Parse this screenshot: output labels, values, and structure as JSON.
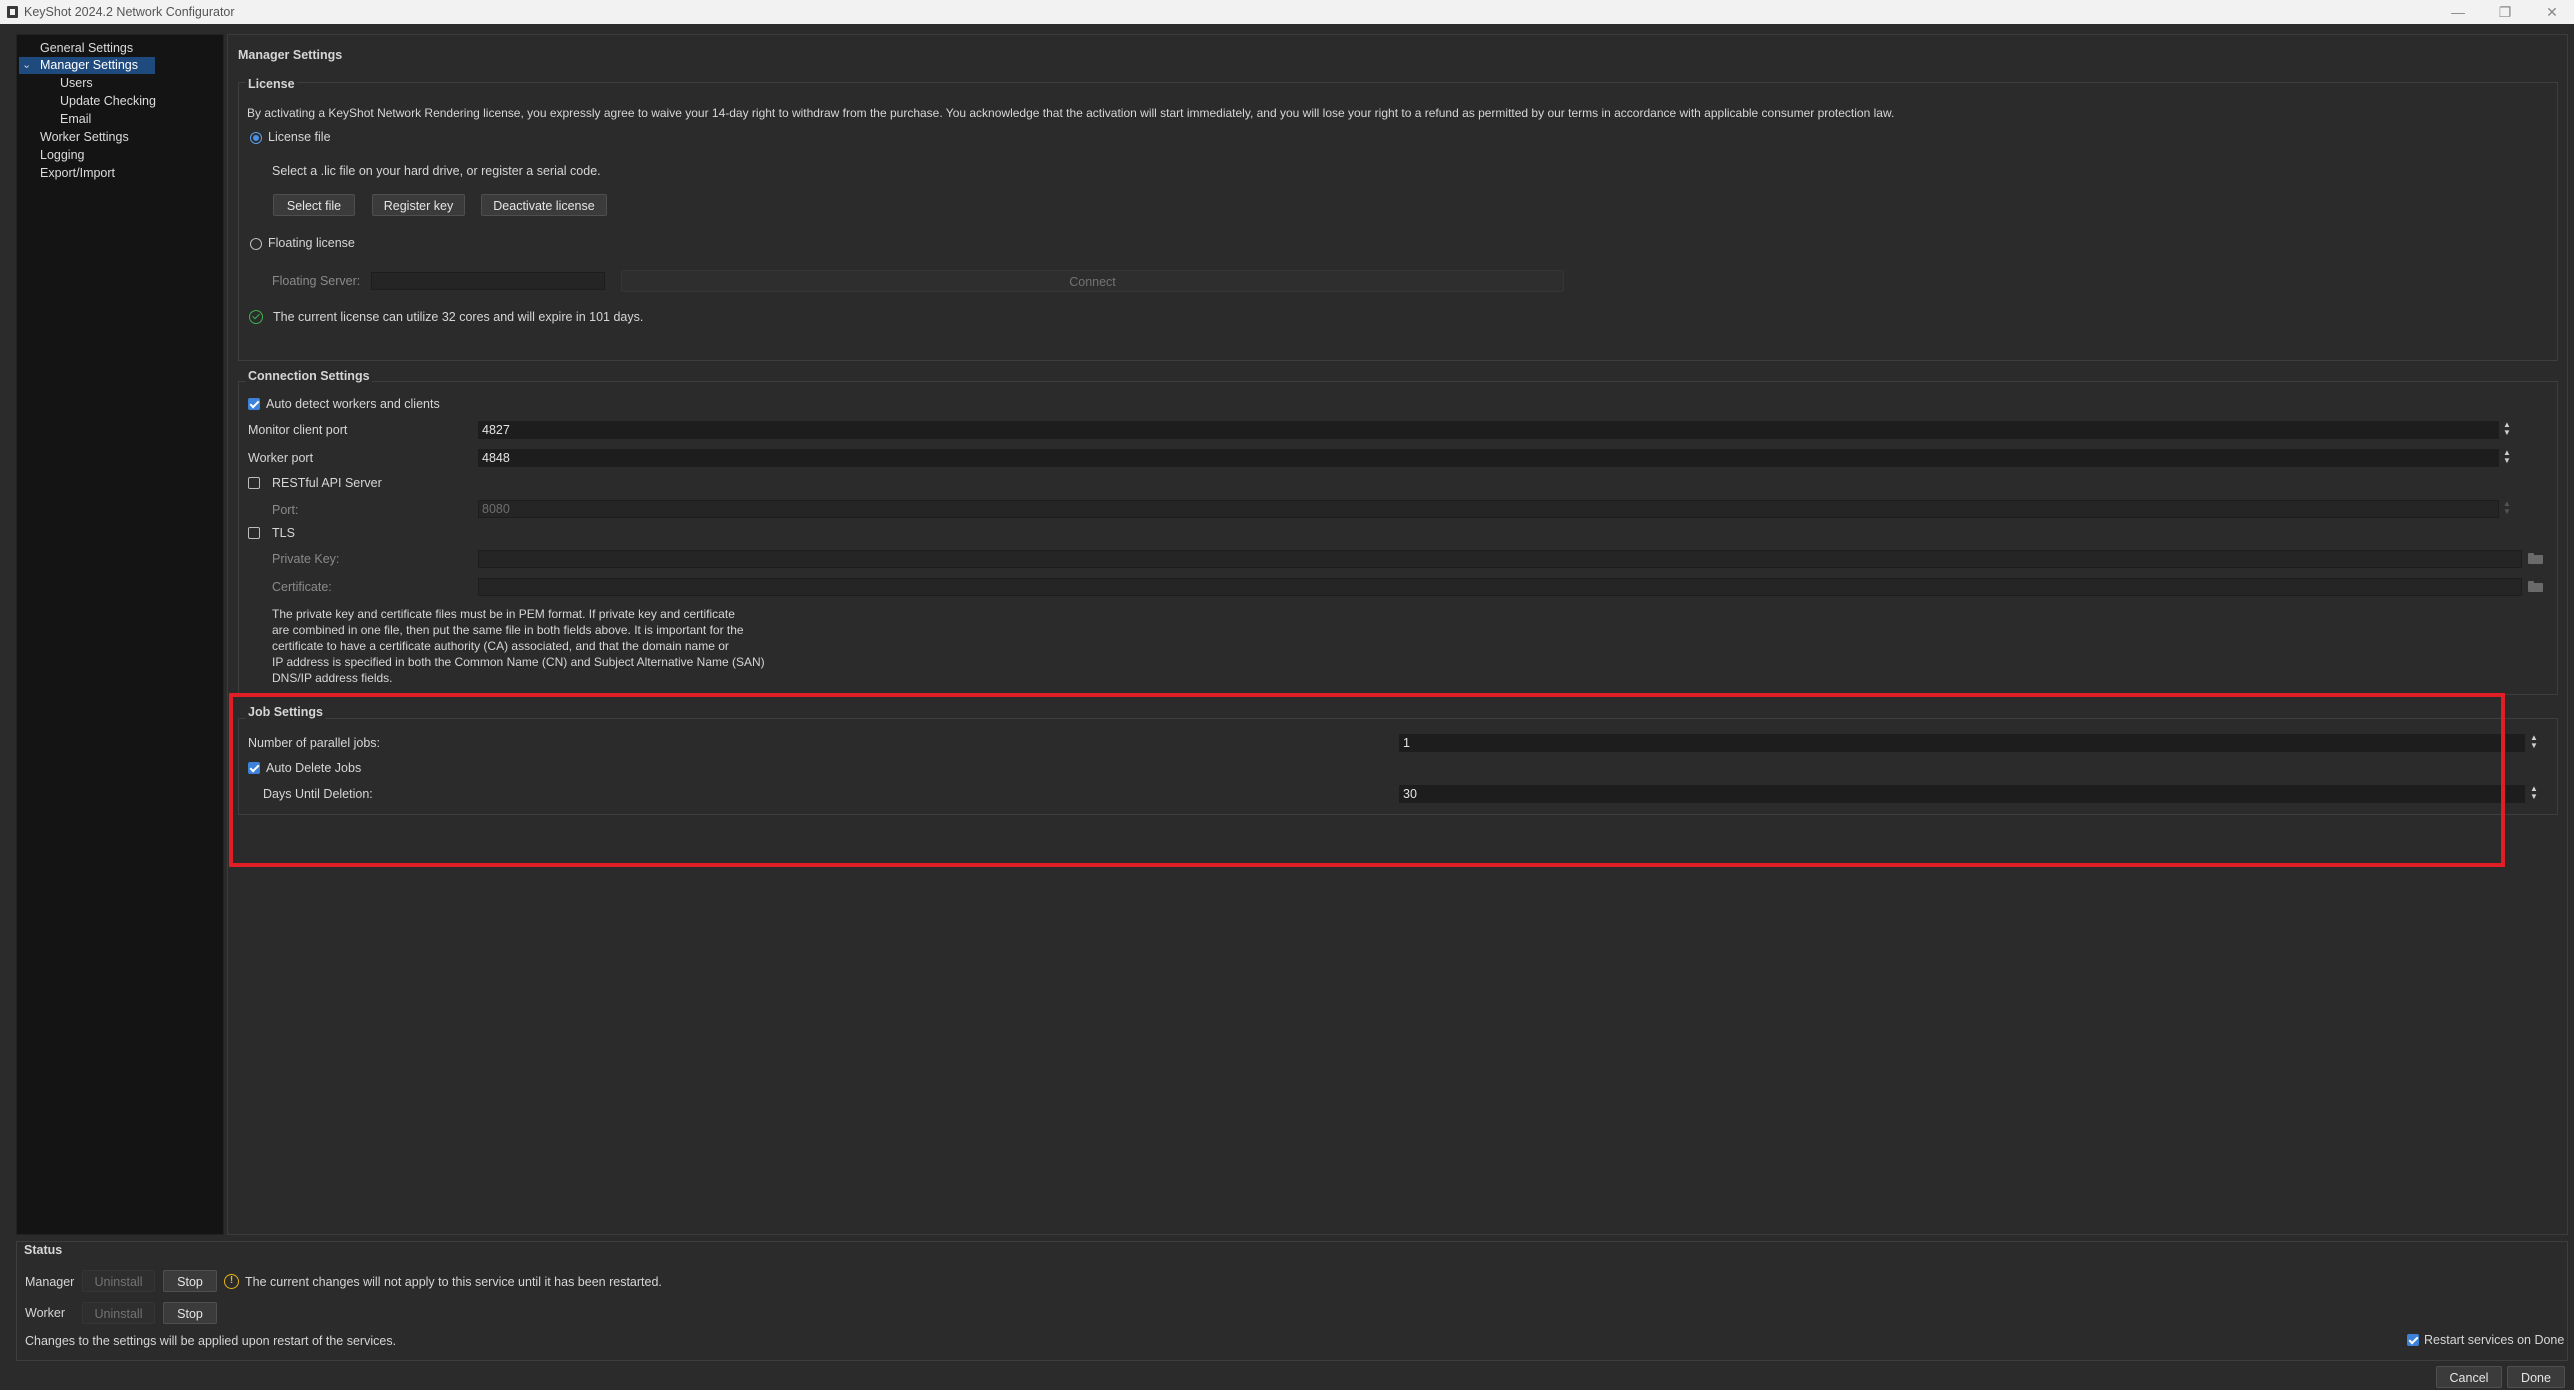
{
  "window": {
    "title": "KeyShot 2024.2 Network Configurator",
    "controls": {
      "minimize": "—",
      "restore": "❐",
      "close": "✕"
    }
  },
  "sidebar": {
    "items": [
      {
        "label": "General Settings"
      },
      {
        "label": "Manager Settings",
        "selected": true,
        "expanded": true
      },
      {
        "label": "Users"
      },
      {
        "label": "Update Checking"
      },
      {
        "label": "Email"
      },
      {
        "label": "Worker Settings"
      },
      {
        "label": "Logging"
      },
      {
        "label": "Export/Import"
      }
    ]
  },
  "page": {
    "title": "Manager Settings"
  },
  "license": {
    "section_title": "License",
    "disclaimer": "By activating a KeyShot Network Rendering license, you expressly agree to waive your 14-day right to withdraw from the purchase. You acknowledge that the activation will start immediately, and you will lose your right to a refund as permitted by our terms in accordance with applicable consumer protection law.",
    "license_file_option": "License file",
    "license_file_selected": true,
    "hint": "Select a .lic file on your hard drive, or register a serial code.",
    "buttons": {
      "select_file": "Select file",
      "register_key": "Register key",
      "deactivate": "Deactivate license"
    },
    "floating_option": "Floating license",
    "floating_server_label": "Floating Server:",
    "floating_server_value": "",
    "connect_button": "Connect",
    "status_text": "The current license can utilize 32 cores and will expire in 101 days."
  },
  "connection": {
    "section_title": "Connection Settings",
    "auto_detect_label": "Auto detect workers and clients",
    "auto_detect_checked": true,
    "monitor_port_label": "Monitor client port",
    "monitor_port_value": "4827",
    "worker_port_label": "Worker port",
    "worker_port_value": "4848",
    "restful_label": "RESTful API Server",
    "restful_checked": false,
    "port_label": "Port:",
    "port_value": "8080",
    "tls_label": "TLS",
    "tls_checked": false,
    "private_key_label": "Private Key:",
    "certificate_label": "Certificate:",
    "pem_note": [
      "The private key and certificate files must be in PEM format. If private key and certificate",
      "are combined in one file, then put the same file in both fields above. It is important for the",
      "certificate to have a certificate authority (CA) associated, and that the domain name or",
      "IP address is specified in both the Common Name (CN) and Subject Alternative Name (SAN)",
      "DNS/IP address fields."
    ]
  },
  "jobs": {
    "section_title": "Job Settings",
    "parallel_label": "Number of parallel jobs:",
    "parallel_value": "1",
    "auto_delete_label": "Auto Delete Jobs",
    "auto_delete_checked": true,
    "days_label": "Days Until Deletion:",
    "days_value": "30"
  },
  "status": {
    "section_title": "Status",
    "manager_label": "Manager",
    "worker_label": "Worker",
    "uninstall_label": "Uninstall",
    "stop_label": "Stop",
    "warning_text": "The current changes will not apply to this service until it has been restarted.",
    "apply_note": "Changes to the settings will be applied upon restart of the services.",
    "restart_label": "Restart services on Done",
    "restart_checked": true
  },
  "footer": {
    "cancel_label": "Cancel",
    "done_label": "Done"
  },
  "colors": {
    "highlight": "#e01e25",
    "selection": "#1f4a7e",
    "check": "#3d82d8",
    "ok": "#3fb04f",
    "warning": "#e7b416"
  }
}
